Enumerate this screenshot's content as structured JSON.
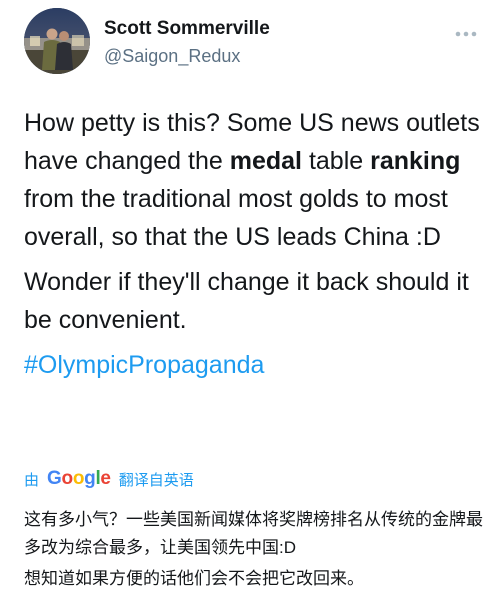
{
  "author": {
    "name": "Scott Sommerville",
    "handle": "@Saigon_Redux",
    "avatar_icon": "user-avatar-photo"
  },
  "more_icon": "more-options-icon",
  "tweet": {
    "p1_a": "How petty is this?  Some US news outlets have changed the ",
    "p1_bold1": "medal",
    "p1_b": " table ",
    "p1_bold2": "ranking",
    "p1_c": " from the traditional most golds to most overall, so that the US leads China :D",
    "p2": "Wonder if they'll change it back should it be convenient.",
    "hashtag": "#OlympicPropaganda"
  },
  "translation": {
    "by_label": "由",
    "provider": "Google",
    "action_label": "翻译自英语",
    "text_p1": "这有多小气？一些美国新闻媒体将奖牌榜排名从传统的金牌最多改为综合最多，让美国领先中国:D",
    "text_p2": "想知道如果方便的话他们会不会把它改回来。"
  },
  "colors": {
    "link": "#1d9bf0",
    "text": "#14171a",
    "secondary": "#5b7083",
    "google_blue": "#4285F4",
    "google_red": "#EA4335",
    "google_yellow": "#FBBC05",
    "google_green": "#34A853"
  }
}
